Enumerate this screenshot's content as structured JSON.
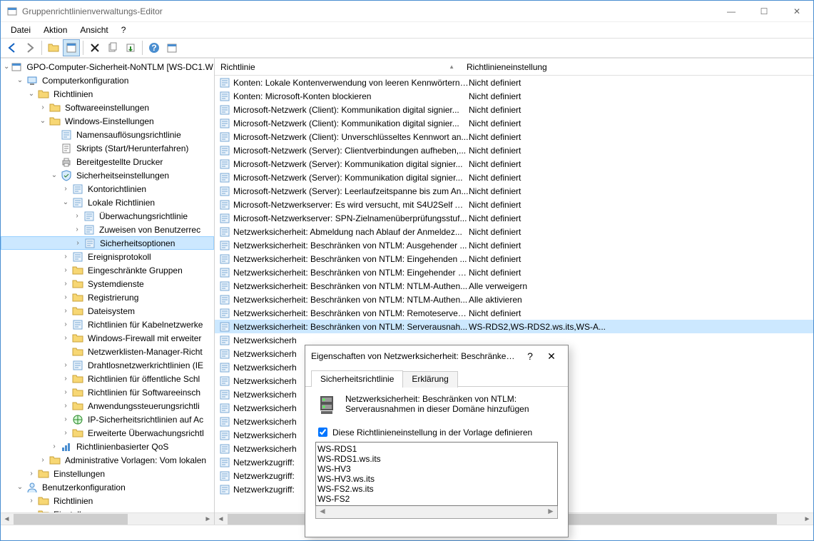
{
  "window": {
    "title": "Gruppenrichtlinienverwaltungs-Editor"
  },
  "menubar": [
    "Datei",
    "Aktion",
    "Ansicht",
    "?"
  ],
  "tree": [
    {
      "ind": 0,
      "exp": "v",
      "icon": "gpo",
      "label": "GPO-Computer-Sicherheit-NoNTLM [WS-DC1.W"
    },
    {
      "ind": 1,
      "exp": "v",
      "icon": "comp",
      "label": "Computerkonfiguration"
    },
    {
      "ind": 2,
      "exp": "v",
      "icon": "folder",
      "label": "Richtlinien"
    },
    {
      "ind": 3,
      "exp": ">",
      "icon": "folder",
      "label": "Softwareeinstellungen"
    },
    {
      "ind": 3,
      "exp": "v",
      "icon": "folder",
      "label": "Windows-Einstellungen"
    },
    {
      "ind": 4,
      "exp": "",
      "icon": "policy",
      "label": "Namensauflösungsrichtlinie"
    },
    {
      "ind": 4,
      "exp": "",
      "icon": "script",
      "label": "Skripts (Start/Herunterfahren)"
    },
    {
      "ind": 4,
      "exp": "",
      "icon": "printer",
      "label": "Bereitgestellte Drucker"
    },
    {
      "ind": 4,
      "exp": "v",
      "icon": "security",
      "label": "Sicherheitseinstellungen"
    },
    {
      "ind": 5,
      "exp": ">",
      "icon": "policy",
      "label": "Kontorichtlinien"
    },
    {
      "ind": 5,
      "exp": "v",
      "icon": "policy",
      "label": "Lokale Richtlinien"
    },
    {
      "ind": 6,
      "exp": ">",
      "icon": "policy",
      "label": "Überwachungsrichtlinie"
    },
    {
      "ind": 6,
      "exp": ">",
      "icon": "policy",
      "label": "Zuweisen von Benutzerrec"
    },
    {
      "ind": 6,
      "exp": ">",
      "icon": "policy",
      "label": "Sicherheitsoptionen",
      "sel": true
    },
    {
      "ind": 5,
      "exp": ">",
      "icon": "policy",
      "label": "Ereignisprotokoll"
    },
    {
      "ind": 5,
      "exp": ">",
      "icon": "folder",
      "label": "Eingeschränkte Gruppen"
    },
    {
      "ind": 5,
      "exp": ">",
      "icon": "folder",
      "label": "Systemdienste"
    },
    {
      "ind": 5,
      "exp": ">",
      "icon": "folder",
      "label": "Registrierung"
    },
    {
      "ind": 5,
      "exp": ">",
      "icon": "folder",
      "label": "Dateisystem"
    },
    {
      "ind": 5,
      "exp": ">",
      "icon": "policy",
      "label": "Richtlinien für Kabelnetzwerke"
    },
    {
      "ind": 5,
      "exp": ">",
      "icon": "folder",
      "label": "Windows-Firewall mit erweiter"
    },
    {
      "ind": 5,
      "exp": "",
      "icon": "folder",
      "label": "Netzwerklisten-Manager-Richt"
    },
    {
      "ind": 5,
      "exp": ">",
      "icon": "policy",
      "label": "Drahtlosnetzwerkrichtlinien (IE"
    },
    {
      "ind": 5,
      "exp": ">",
      "icon": "folder",
      "label": "Richtlinien für öffentliche Schl"
    },
    {
      "ind": 5,
      "exp": ">",
      "icon": "folder",
      "label": "Richtlinien für Softwareeinsch"
    },
    {
      "ind": 5,
      "exp": ">",
      "icon": "folder",
      "label": "Anwendungssteuerungsrichtli"
    },
    {
      "ind": 5,
      "exp": ">",
      "icon": "ipsec",
      "label": "IP-Sicherheitsrichtlinien auf Ac"
    },
    {
      "ind": 5,
      "exp": ">",
      "icon": "folder",
      "label": "Erweiterte Überwachungsrichtl"
    },
    {
      "ind": 4,
      "exp": ">",
      "icon": "qos",
      "label": "Richtlinienbasierter QoS"
    },
    {
      "ind": 3,
      "exp": ">",
      "icon": "folder",
      "label": "Administrative Vorlagen: Vom lokalen"
    },
    {
      "ind": 2,
      "exp": ">",
      "icon": "folder",
      "label": "Einstellungen"
    },
    {
      "ind": 1,
      "exp": "v",
      "icon": "user",
      "label": "Benutzerkonfiguration"
    },
    {
      "ind": 2,
      "exp": ">",
      "icon": "folder",
      "label": "Richtlinien"
    },
    {
      "ind": 2,
      "exp": ">",
      "icon": "folder",
      "label": "Einstellungen"
    }
  ],
  "columns": {
    "c1": "Richtlinie",
    "c2": "Richtlinieneinstellung"
  },
  "policies": [
    {
      "n": "Konten: Lokale Kontenverwendung von leeren Kennwörtern ...",
      "v": "Nicht definiert"
    },
    {
      "n": "Konten: Microsoft-Konten blockieren",
      "v": "Nicht definiert"
    },
    {
      "n": "Microsoft-Netzwerk (Client): Kommunikation digital signier...",
      "v": "Nicht definiert"
    },
    {
      "n": "Microsoft-Netzwerk (Client): Kommunikation digital signier...",
      "v": "Nicht definiert"
    },
    {
      "n": "Microsoft-Netzwerk (Client): Unverschlüsseltes Kennwort an...",
      "v": "Nicht definiert"
    },
    {
      "n": "Microsoft-Netzwerk (Server): Clientverbindungen aufheben,...",
      "v": "Nicht definiert"
    },
    {
      "n": "Microsoft-Netzwerk (Server): Kommunikation digital signier...",
      "v": "Nicht definiert"
    },
    {
      "n": "Microsoft-Netzwerk (Server): Kommunikation digital signier...",
      "v": "Nicht definiert"
    },
    {
      "n": "Microsoft-Netzwerk (Server): Leerlaufzeitspanne bis zum An...",
      "v": "Nicht definiert"
    },
    {
      "n": "Microsoft-Netzwerkserver: Es wird versucht, mit S4U2Self An...",
      "v": "Nicht definiert"
    },
    {
      "n": "Microsoft-Netzwerkserver: SPN-Zielnamenüberprüfungsstuf...",
      "v": "Nicht definiert"
    },
    {
      "n": "Netzwerksicherheit: Abmeldung nach Ablauf der Anmeldez...",
      "v": "Nicht definiert"
    },
    {
      "n": "Netzwerksicherheit: Beschränken von NTLM: Ausgehender ...",
      "v": "Nicht definiert"
    },
    {
      "n": "Netzwerksicherheit: Beschränken von NTLM: Eingehenden ...",
      "v": "Nicht definiert"
    },
    {
      "n": "Netzwerksicherheit: Beschränken von NTLM: Eingehender N...",
      "v": "Nicht definiert"
    },
    {
      "n": "Netzwerksicherheit: Beschränken von NTLM: NTLM-Authen...",
      "v": "Alle verweigern"
    },
    {
      "n": "Netzwerksicherheit: Beschränken von NTLM: NTLM-Authen...",
      "v": "Alle aktivieren"
    },
    {
      "n": "Netzwerksicherheit: Beschränken von NTLM: Remoteserverva...",
      "v": "Nicht definiert"
    },
    {
      "n": "Netzwerksicherheit: Beschränken von NTLM: Serverausnah...",
      "v": "WS-RDS2,WS-RDS2.ws.its,WS-A...",
      "sel": true
    },
    {
      "n": "Netzwerksicherh",
      "v": ""
    },
    {
      "n": "Netzwerksicherh",
      "v": ""
    },
    {
      "n": "Netzwerksicherh",
      "v": ""
    },
    {
      "n": "Netzwerksicherh",
      "v": ""
    },
    {
      "n": "Netzwerksicherh",
      "v": ""
    },
    {
      "n": "Netzwerksicherh",
      "v": ""
    },
    {
      "n": "Netzwerksicherh",
      "v": ""
    },
    {
      "n": "Netzwerksicherh",
      "v": ""
    },
    {
      "n": "Netzwerksicherh",
      "v": ""
    },
    {
      "n": "Netzwerkzugriff:",
      "v": ""
    },
    {
      "n": "Netzwerkzugriff:",
      "v": ""
    },
    {
      "n": "Netzwerkzugriff:",
      "v": ""
    }
  ],
  "dialog": {
    "title": "Eigenschaften von Netzwerksicherheit: Beschränken von ...",
    "tab1": "Sicherheitsrichtlinie",
    "tab2": "Erklärung",
    "policyName": "Netzwerksicherheit: Beschränken von NTLM: Serverausnahmen in dieser Domäne hinzufügen",
    "checkbox": "Diese Richtlinieneinstellung in der Vorlage definieren",
    "valueList": "WS-RDS1\nWS-RDS1.ws.its\nWS-HV3\nWS-HV3.ws.its\nWS-FS2.ws.its\nWS-FS2"
  }
}
